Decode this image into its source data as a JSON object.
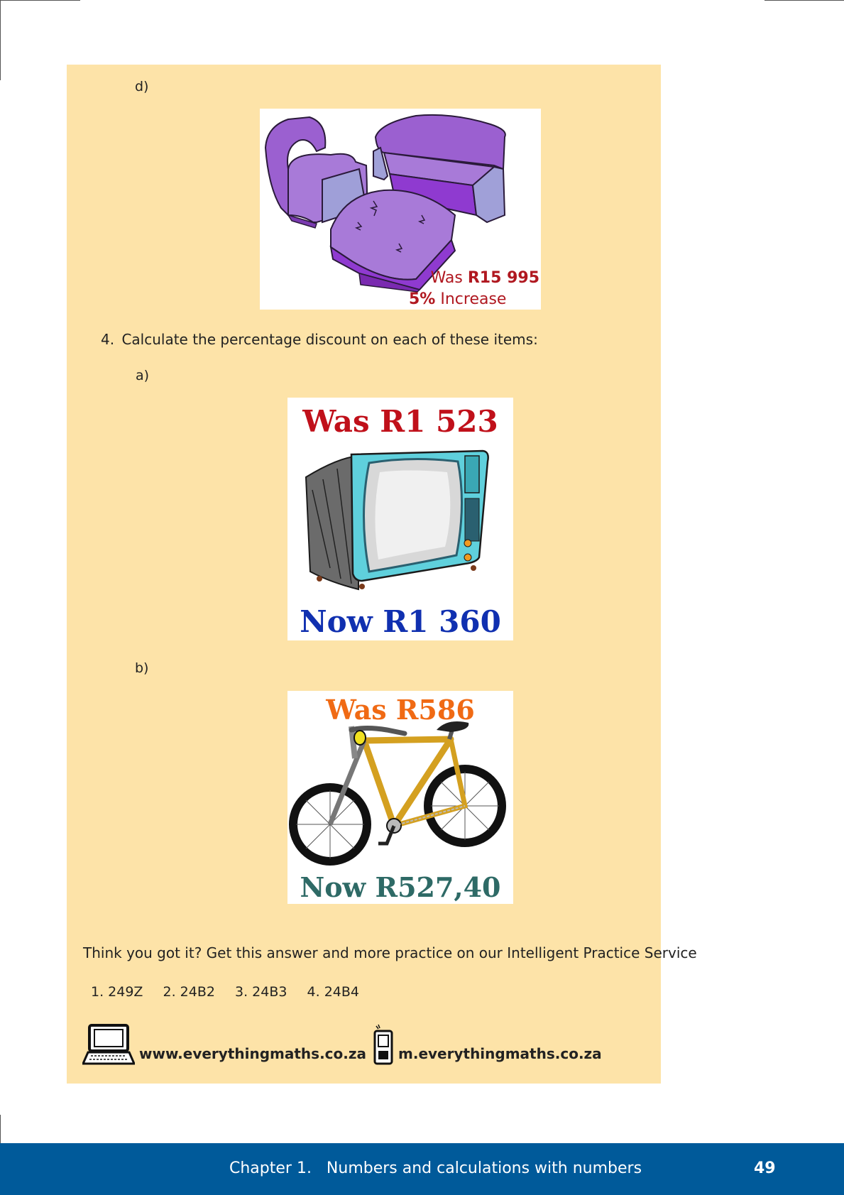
{
  "items": {
    "d_label": "d)",
    "sofa": {
      "was_prefix": "Was ",
      "was_price": "R15 995",
      "pct": "5%",
      "change": " Increase"
    },
    "question_number": "4.",
    "question_text": "Calculate the percentage discount on each of these items:",
    "a_label": "a)",
    "tv": {
      "was": "Was R1 523",
      "now": "Now R1 360"
    },
    "b_label": "b)",
    "bike": {
      "was": "Was R586",
      "now": "Now R527,40"
    }
  },
  "practice": {
    "text": "Think you got it? Get this answer and more practice on our Intelligent Practice Service",
    "codes": [
      "1. 249Z",
      "2. 24B2",
      "3. 24B3",
      "4. 24B4"
    ],
    "web": "www.everythingmaths.co.za",
    "mobile": "m.everythingmaths.co.za"
  },
  "footer": {
    "chapter": "Chapter 1.   Numbers and calculations with numbers",
    "page": "49"
  },
  "colors": {
    "box_bg": "#fde3a8",
    "footer_bg": "#005a9a",
    "was_red": "#c0101a",
    "now_blue": "#1030b0",
    "bike_orange": "#f06a14",
    "bike_teal": "#2e6a66",
    "sofa_purple": "#9b60d0"
  }
}
